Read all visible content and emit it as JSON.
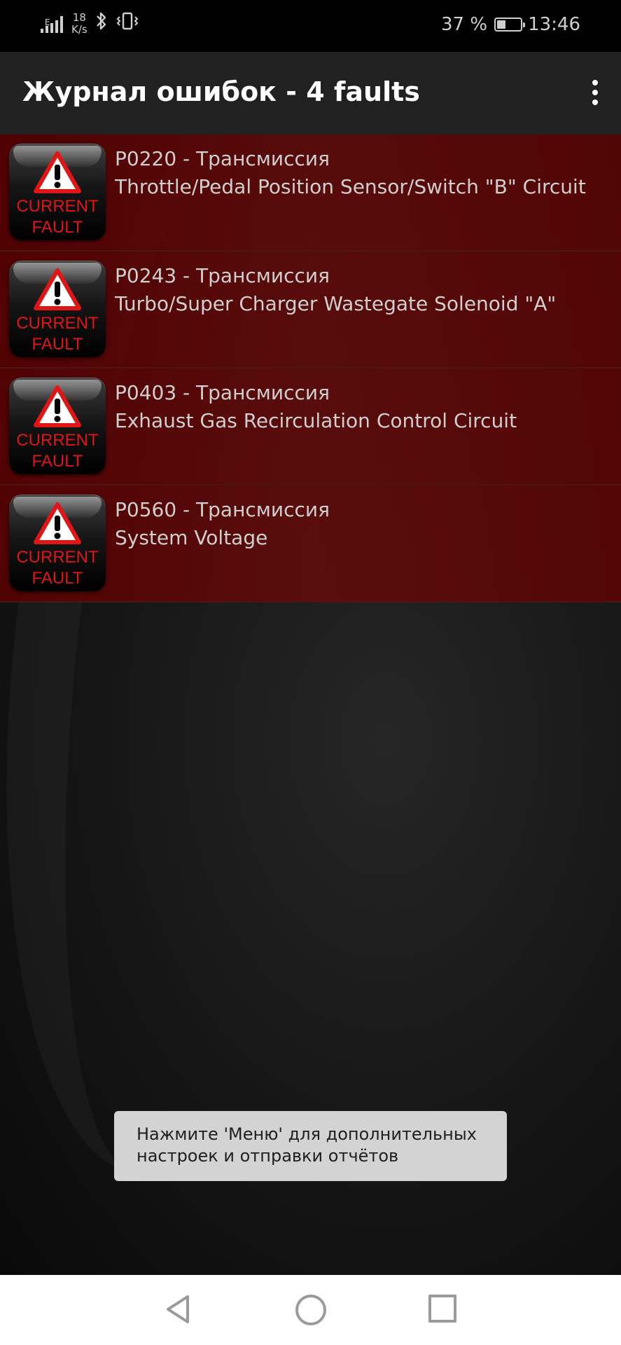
{
  "status_bar": {
    "network_type": "E",
    "net_speed_value": "18",
    "net_speed_unit": "K/s",
    "bluetooth_icon": "bluetooth-icon",
    "vibrate_icon": "vibrate-icon",
    "battery_text": "37 %",
    "battery_level": 0.37,
    "time": "13:46"
  },
  "app_bar": {
    "title": "Журнал ошибок - 4 faults",
    "menu_icon": "more-vert-icon"
  },
  "faults": [
    {
      "badge_line1": "CURRENT",
      "badge_line2": "FAULT",
      "code": "P0220 - Трансмиссия",
      "description": "Throttle/Pedal Position Sensor/Switch \"B\" Circuit"
    },
    {
      "badge_line1": "CURRENT",
      "badge_line2": "FAULT",
      "code": "P0243 - Трансмиссия",
      "description": "Turbo/Super Charger Wastegate Solenoid \"A\""
    },
    {
      "badge_line1": "CURRENT",
      "badge_line2": "FAULT",
      "code": "P0403 - Трансмиссия",
      "description": "Exhaust Gas Recirculation Control Circuit"
    },
    {
      "badge_line1": "CURRENT",
      "badge_line2": "FAULT",
      "code": "P0560 - Трансмиссия",
      "description": "System Voltage"
    }
  ],
  "toast": {
    "line1": "Нажмите 'Меню' для дополнительных",
    "line2": "настроек и отправки отчётов"
  },
  "colors": {
    "fault_row": "#5a0000",
    "badge_text": "#e01616",
    "app_bar": "#212121",
    "toast_bg": "#d3d3d3"
  },
  "nav_bar": {
    "back_icon": "back-triangle-icon",
    "home_icon": "home-circle-icon",
    "recent_icon": "recent-apps-square-icon"
  }
}
